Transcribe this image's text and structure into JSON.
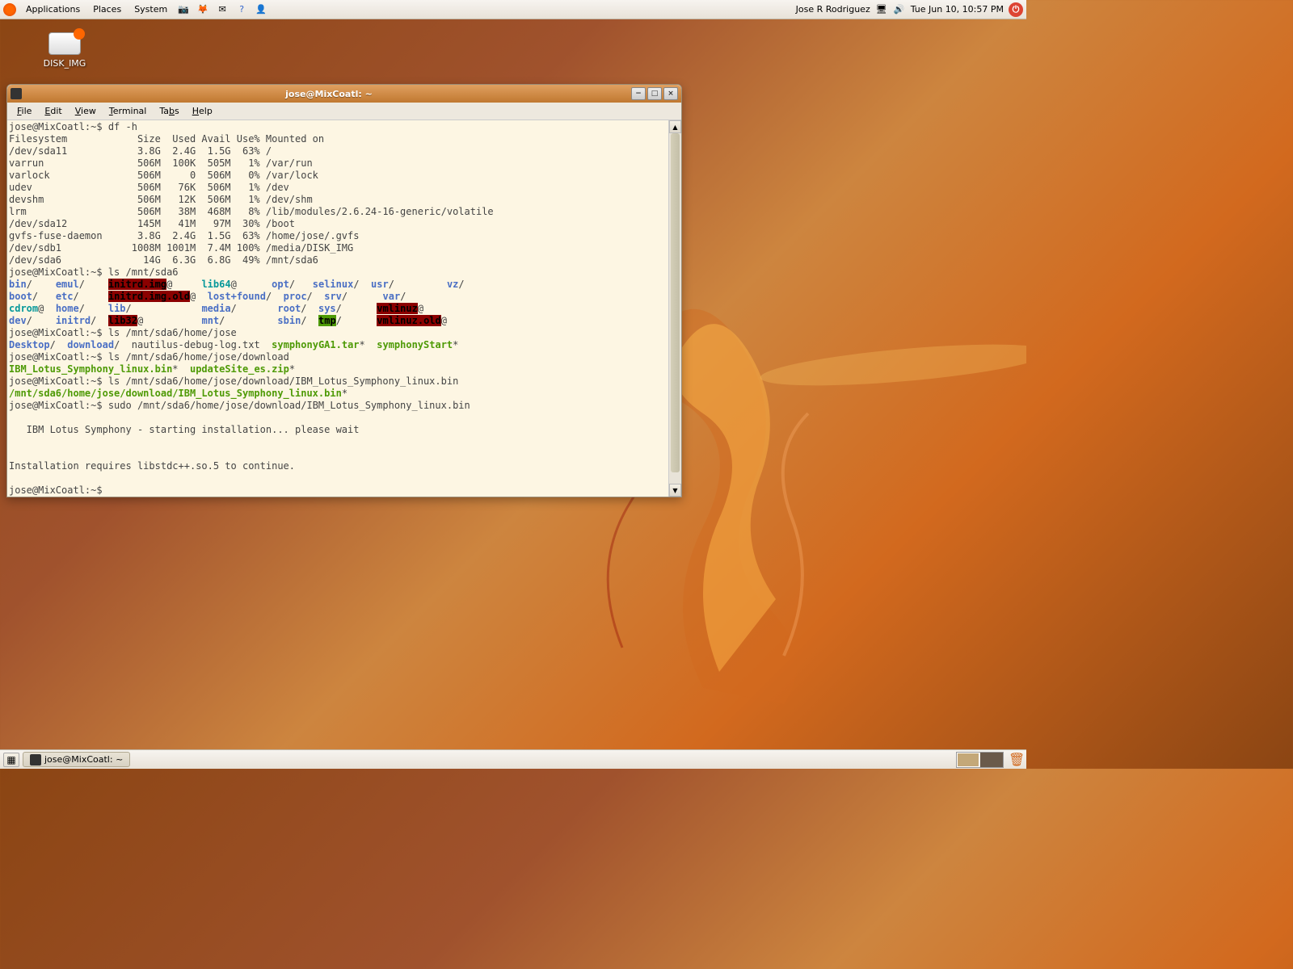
{
  "panel": {
    "applications": "Applications",
    "places": "Places",
    "system": "System",
    "user": "Jose R Rodriguez",
    "datetime": "Tue Jun 10, 10:57 PM"
  },
  "desktop": {
    "disk_label": "DISK_IMG"
  },
  "window": {
    "title": "jose@MixCoatl: ~",
    "menus": {
      "file": "File",
      "edit": "Edit",
      "view": "View",
      "terminal": "Terminal",
      "tabs": "Tabs",
      "help": "Help"
    }
  },
  "terminal": {
    "prompt": "jose@MixCoatl:~$",
    "cmd_df": "df -h",
    "df_header": "Filesystem            Size  Used Avail Use% Mounted on",
    "df_rows": [
      "/dev/sda11            3.8G  2.4G  1.5G  63% /",
      "varrun                506M  100K  505M   1% /var/run",
      "varlock               506M     0  506M   0% /var/lock",
      "udev                  506M   76K  506M   1% /dev",
      "devshm                506M   12K  506M   1% /dev/shm",
      "lrm                   506M   38M  468M   8% /lib/modules/2.6.24-16-generic/volatile",
      "/dev/sda12            145M   41M   97M  30% /boot",
      "gvfs-fuse-daemon      3.8G  2.4G  1.5G  63% /home/jose/.gvfs",
      "/dev/sdb1            1008M 1001M  7.4M 100% /media/DISK_IMG",
      "/dev/sda6              14G  6.3G  6.8G  49% /mnt/sda6"
    ],
    "cmd_ls1": "ls /mnt/sda6",
    "cmd_ls2": "ls /mnt/sda6/home/jose",
    "ls2_items": {
      "desktop": "Desktop",
      "download": "download",
      "nautilus": "nautilus-debug-log.txt",
      "symga": "symphonyGA1.tar",
      "symstart": "symphonyStart"
    },
    "cmd_ls3": "ls /mnt/sda6/home/jose/download",
    "ls3_items": {
      "ibm": "IBM_Lotus_Symphony_linux.bin",
      "update": "updateSite_es.zip"
    },
    "cmd_ls4": "ls /mnt/sda6/home/jose/download/IBM_Lotus_Symphony_linux.bin",
    "ls4_out": "/mnt/sda6/home/jose/download/IBM_Lotus_Symphony_linux.bin",
    "cmd_sudo": "sudo /mnt/sda6/home/jose/download/IBM_Lotus_Symphony_linux.bin",
    "install_msg1": "   IBM Lotus Symphony - starting installation... please wait",
    "install_msg2": "Installation requires libstdc++.so.5 to continue.",
    "ls1": {
      "bin": "bin",
      "emul": "emul",
      "initrd_img": "initrd.img",
      "lib64": "lib64",
      "opt": "opt",
      "selinux": "selinux",
      "usr": "usr",
      "vz": "vz",
      "boot": "boot",
      "etc": "etc",
      "initrd_old": "initrd.img.old",
      "lostfound": "lost+found",
      "proc": "proc",
      "srv": "srv",
      "var": "var",
      "cdrom": "cdrom",
      "home": "home",
      "lib": "lib",
      "media": "media",
      "root": "root",
      "sys": "sys",
      "vmlinuz": "vmlinuz",
      "dev": "dev",
      "initrd": "initrd",
      "lib32": "lib32",
      "mnt": "mnt",
      "sbin": "sbin",
      "tmp": "tmp",
      "vmlinuz_old": "vmlinuz.old"
    }
  },
  "taskbar": {
    "terminal_task": "jose@MixCoatl: ~"
  }
}
